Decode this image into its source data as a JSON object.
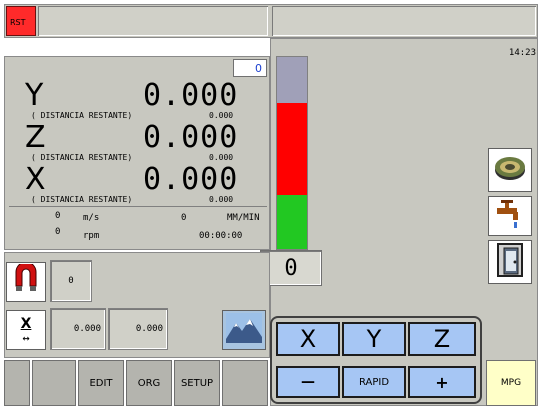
{
  "header": {
    "rst_label": "RST",
    "clock": "14:23"
  },
  "dro": {
    "tool_number": "0",
    "axes": [
      {
        "letter": "Y",
        "value": "0.000",
        "sub_label": "( DISTANCIA RESTANTE)",
        "remaining": "0.000"
      },
      {
        "letter": "Z",
        "value": "0.000",
        "sub_label": "( DISTANCIA RESTANTE)",
        "remaining": "0.000"
      },
      {
        "letter": "X",
        "value": "0.000",
        "sub_label": "( DISTANCIA RESTANTE)",
        "remaining": "0.000"
      }
    ],
    "speed_value": "0",
    "speed_unit": "m/s",
    "feed_value": "0",
    "feed_unit": "MM/MIN",
    "spindle_value": "0",
    "spindle_unit": "rpm",
    "elapsed_time": "00:00:00"
  },
  "gauge": {
    "value": "0",
    "colors": {
      "top": "#a0a0b8",
      "middle": "#ff0000",
      "bottom": "#22c822"
    }
  },
  "left_controls": {
    "magnet_value": "0",
    "axis_select_label": "X",
    "field_a": "0.000",
    "field_b": "0.000"
  },
  "side_icons": [
    "round-part-icon",
    "coolant-tap-icon",
    "door-icon"
  ],
  "jog": {
    "axes": [
      "X",
      "Y",
      "Z"
    ],
    "minus_label": "—",
    "rapid_label": "RAPID",
    "plus_label": "+"
  },
  "softkeys": [
    "",
    "",
    "EDIT",
    "ORG",
    "SETUP",
    "",
    ""
  ],
  "mpg_label": "MPG",
  "colors": {
    "panel": "#c8c8c0",
    "accent_blue": "#a6c6f4",
    "rst_red": "#ff2a2a",
    "mpg_yellow": "#ffffc8"
  }
}
